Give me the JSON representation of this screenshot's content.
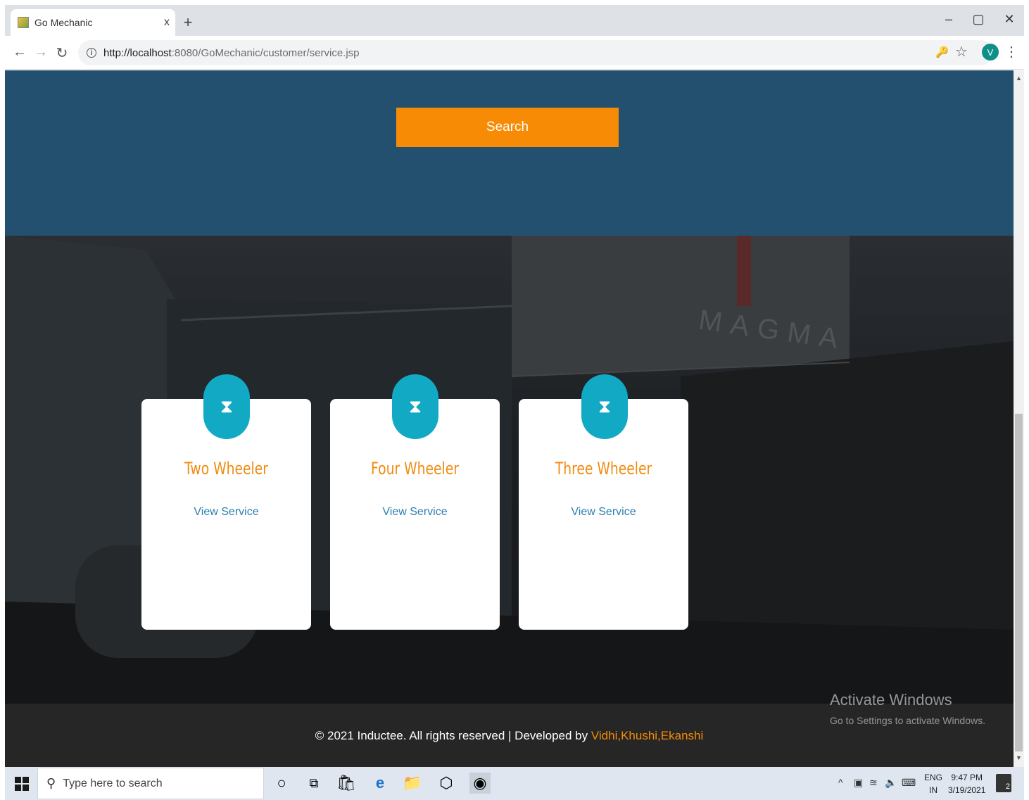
{
  "browser": {
    "tab_title": "Go Mechanic",
    "tab_close": "x",
    "new_tab": "+",
    "url_host": "http://localhost",
    "url_path": ":8080/GoMechanic/customer/service.jsp",
    "profile_initial": "V"
  },
  "hero": {
    "search_label": "Search",
    "accent_color": "#f78b05",
    "bg_color": "#23506f"
  },
  "services": [
    {
      "title": "Two Wheeler",
      "link": "View Service",
      "icon": "hourglass-icon"
    },
    {
      "title": "Four Wheeler",
      "link": "View Service",
      "icon": "hourglass-icon"
    },
    {
      "title": "Three Wheeler",
      "link": "View Service",
      "icon": "hourglass-icon"
    }
  ],
  "footer": {
    "copyright": "© 2021 Inductee. All rights reserved | Developed by ",
    "developers": "Vidhi,Khushi,Ekanshi"
  },
  "watermark": {
    "title": "Activate Windows",
    "subtitle": "Go to Settings to activate Windows."
  },
  "taskbar": {
    "search_placeholder": "Type here to search",
    "lang_top": "ENG",
    "lang_bottom": "IN",
    "time": "9:47 PM",
    "date": "3/19/2021",
    "notification_count": "2"
  }
}
